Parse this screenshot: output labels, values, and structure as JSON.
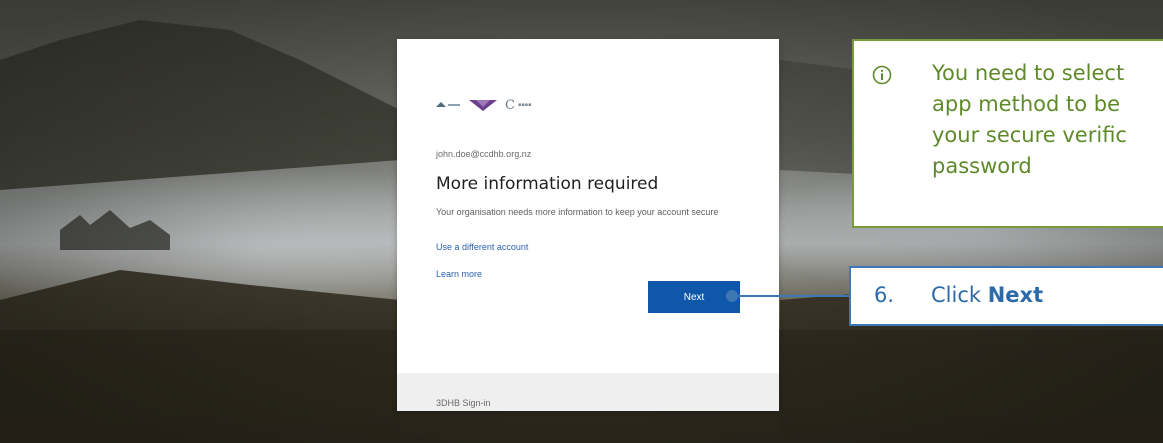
{
  "signin": {
    "email": "john.doe@ccdhb.org.nz",
    "title": "More information required",
    "description": "Your organisation needs more information to keep your account secure",
    "different_account_link": "Use a different account",
    "learn_more_link": "Learn more",
    "next_label": "Next",
    "footer": "3DHB Sign-in",
    "logos": [
      "dhb-logo-1-icon",
      "dhb-logo-2-icon",
      "dhb-logo-3-icon"
    ]
  },
  "callouts": {
    "info": {
      "icon": "info-circle-icon",
      "lines": [
        "You need to select",
        "app method to be",
        "your secure verific",
        "password"
      ]
    },
    "step": {
      "number": "6.",
      "prefix": "Click ",
      "bold": "Next"
    }
  },
  "colors": {
    "info_border": "#7a9a3a",
    "info_text": "#5f8a2a",
    "step_border": "#3d78b5",
    "step_text": "#2d6aa8",
    "next_button": "#0f57a8",
    "link": "#2b63b0"
  }
}
